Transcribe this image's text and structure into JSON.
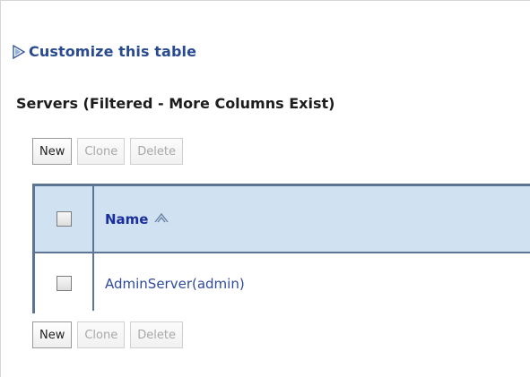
{
  "customize": {
    "label": "Customize this table",
    "icon": "expand-triangle-icon"
  },
  "section": {
    "title": "Servers (Filtered - More Columns Exist)"
  },
  "toolbar": {
    "new_label": "New",
    "clone_label": "Clone",
    "delete_label": "Delete"
  },
  "table": {
    "columns": [
      {
        "label": "Name",
        "sort_icon": "sort-arrows-icon"
      }
    ],
    "rows": [
      {
        "name": "AdminServer(admin)"
      }
    ]
  },
  "colors": {
    "link": "#2a4a8f",
    "header_bg": "#d0e2f2",
    "table_border": "#5b7593"
  }
}
